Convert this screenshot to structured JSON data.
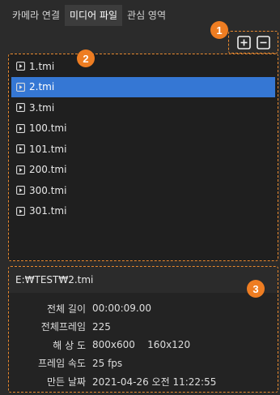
{
  "tabs": [
    {
      "label": "카메라 연결",
      "active": false
    },
    {
      "label": "미디어 파일",
      "active": true
    },
    {
      "label": "관심 영역",
      "active": false
    }
  ],
  "toolbar": {
    "add_icon": "plus-square-icon",
    "remove_icon": "minus-square-icon"
  },
  "badges": [
    "1",
    "2",
    "3"
  ],
  "files": [
    {
      "name": "1.tmi",
      "selected": false
    },
    {
      "name": "2.tmi",
      "selected": true
    },
    {
      "name": "3.tmi",
      "selected": false
    },
    {
      "name": "100.tmi",
      "selected": false
    },
    {
      "name": "101.tmi",
      "selected": false
    },
    {
      "name": "200.tmi",
      "selected": false
    },
    {
      "name": "300.tmi",
      "selected": false
    },
    {
      "name": "301.tmi",
      "selected": false
    }
  ],
  "info": {
    "path": "E:₩TEST₩2.tmi",
    "rows": [
      {
        "label": "전체 길이",
        "value": "00:00:09.00"
      },
      {
        "label": "전체프레임",
        "value": "225"
      },
      {
        "label": "해 상 도",
        "value": "800x600    160x120"
      },
      {
        "label": "프레임 속도",
        "value": "25 fps"
      },
      {
        "label": "만든 날짜",
        "value": "2021-04-26 오전 11:22:55"
      }
    ]
  },
  "colors": {
    "accent": "#ee7d22",
    "selection": "#3577d4",
    "background": "#2b2b2b"
  }
}
